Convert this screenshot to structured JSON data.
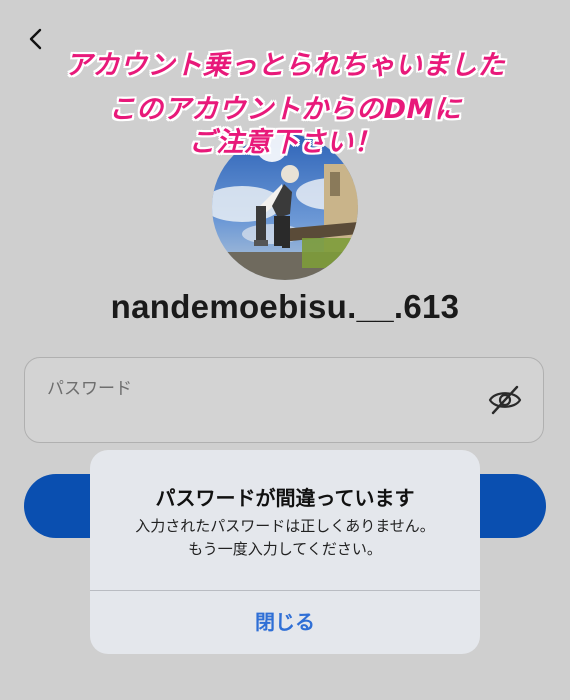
{
  "overlay": {
    "line1": "アカウント乗っとられちゃいました",
    "line2": "このアカウントからのDMに",
    "line3": "ご注意下さい！"
  },
  "profile": {
    "username": "nandemoebisu.__.613"
  },
  "password_field": {
    "label": "パスワード"
  },
  "alert": {
    "title": "パスワードが間違っています",
    "message_line1": "入力されたパスワードは正しくありません。",
    "message_line2": "もう一度入力してください。",
    "close_label": "閉じる"
  },
  "colors": {
    "overlay_text": "#e8197a",
    "login_button": "#0a4fb0",
    "alert_action": "#2f6fd6"
  },
  "icons": {
    "back": "chevron-left-icon",
    "password_visibility": "eye-slash-icon"
  }
}
